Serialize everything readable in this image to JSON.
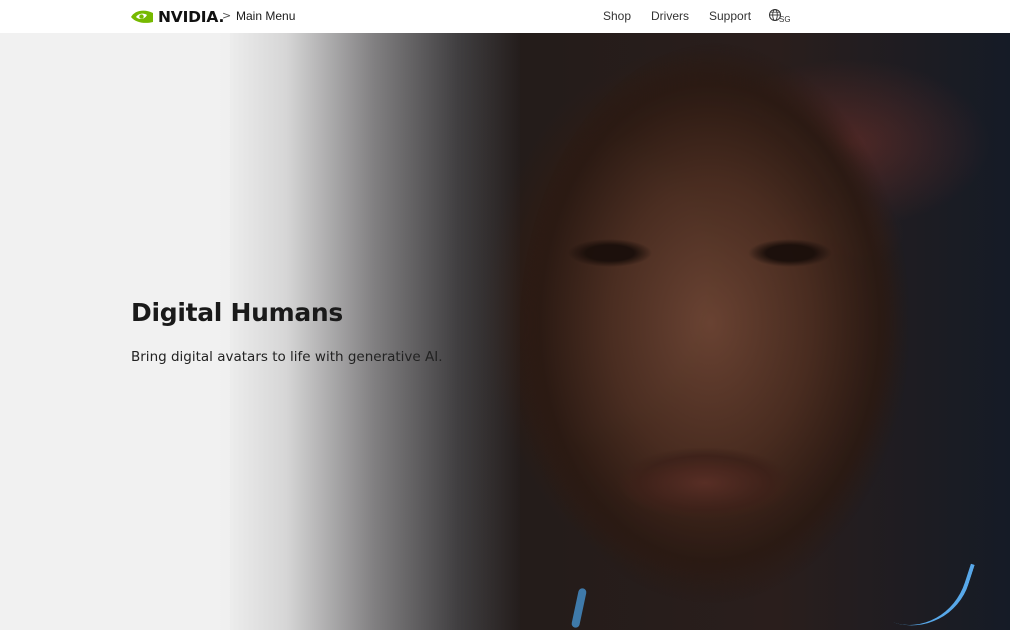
{
  "header": {
    "logo_text": "NVIDIA.",
    "breadcrumb_separator": ">",
    "breadcrumb_label": "Main Menu",
    "nav_links": [
      "Shop",
      "Drivers",
      "Support"
    ],
    "region_label": "SG",
    "logo_icon": "nvidia-eye-icon",
    "region_icon": "globe-icon"
  },
  "hero": {
    "title": "Digital Humans",
    "subtitle": "Bring digital avatars to life with generative AI."
  },
  "colors": {
    "brand_green": "#76b900",
    "hero_background": "#f1f1f1",
    "text_dark": "#1a1a1a",
    "accent_light_blue": "#5fb8ff"
  }
}
